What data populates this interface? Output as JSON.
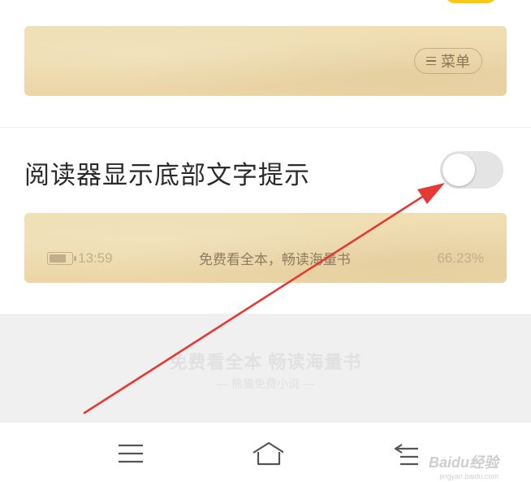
{
  "reader_preview_top": {
    "menu_button_label": "菜单"
  },
  "setting": {
    "label": "阅读器显示底部文字提示",
    "toggle_on": false
  },
  "reader_preview_bottom": {
    "time": "13:59",
    "battery_level": 0.85,
    "tip_text": "免费看全本，畅读海量书",
    "progress": "66.23%"
  },
  "ad_banner": {
    "title": "免费看全本 畅读海量书",
    "subtitle": "— 熊猫免费小说 —"
  },
  "watermark": {
    "brand": "Baidu经验",
    "url": "jingyan.baidu.com"
  },
  "icons": {
    "nav": [
      "menu-icon",
      "home-icon",
      "back-icon"
    ]
  },
  "colors": {
    "paper": "#ecd6a7",
    "toggle_off": "#e4e4e4",
    "accent_yellow": "#f9c81b",
    "annotation_arrow": "#e53935"
  }
}
